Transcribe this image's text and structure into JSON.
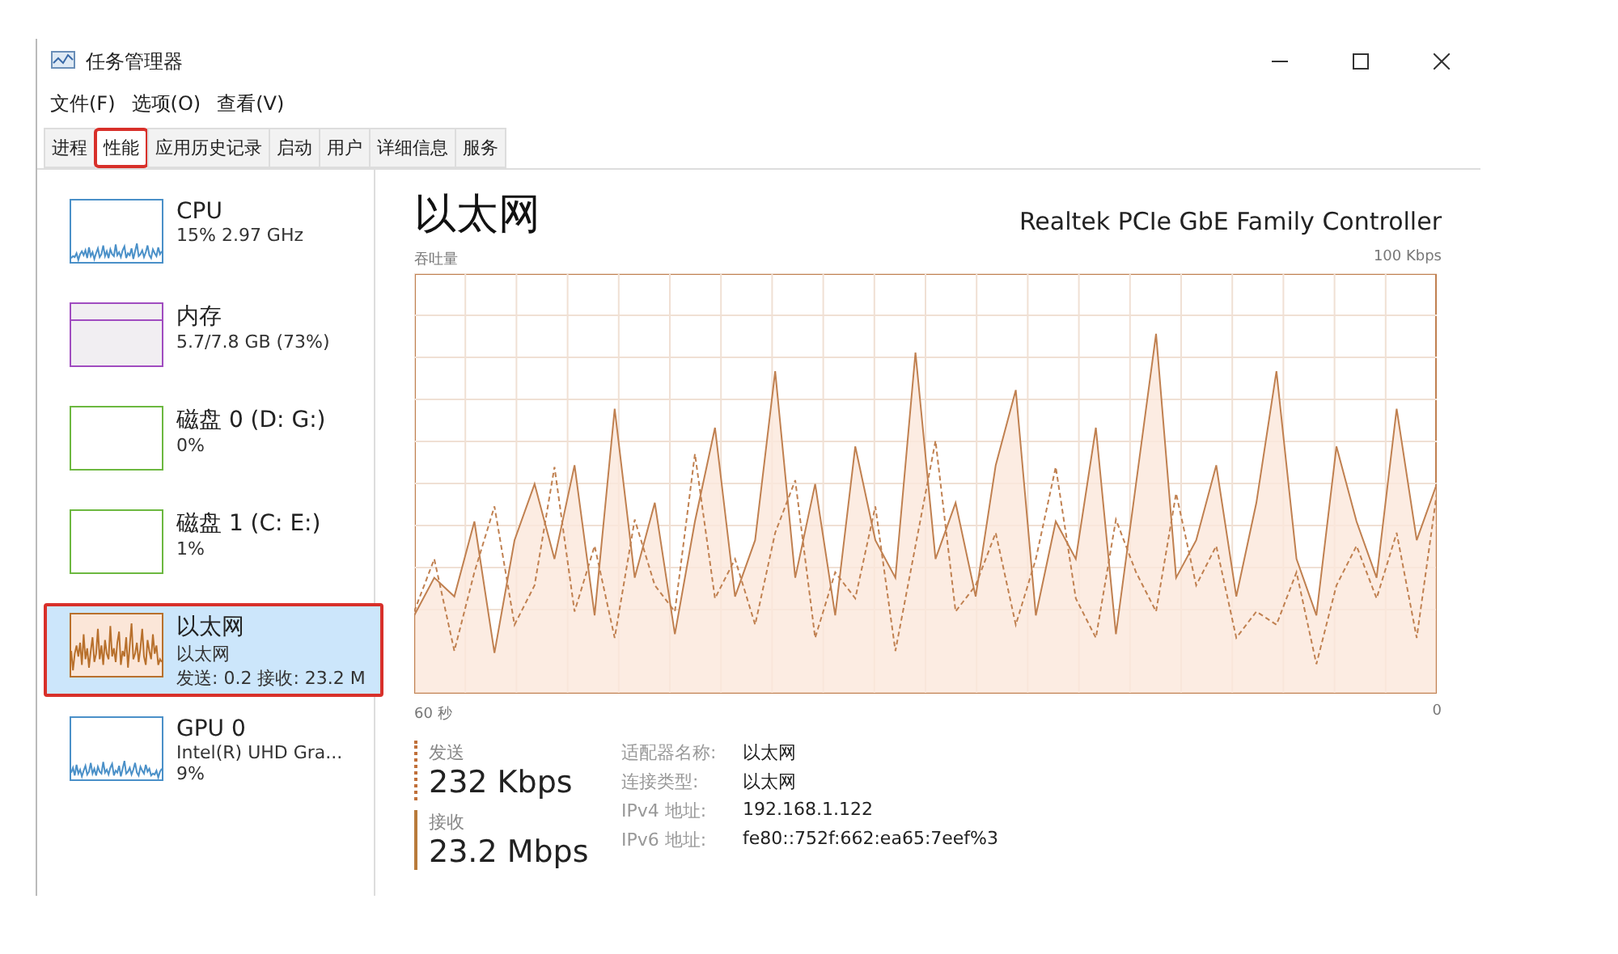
{
  "window": {
    "title": "任务管理器"
  },
  "menu": [
    "文件(F)",
    "选项(O)",
    "查看(V)"
  ],
  "tabs": [
    {
      "label": "进程",
      "selected": false,
      "highlighted": false
    },
    {
      "label": "性能",
      "selected": true,
      "highlighted": true
    },
    {
      "label": "应用历史记录",
      "selected": false,
      "highlighted": false
    },
    {
      "label": "启动",
      "selected": false,
      "highlighted": false
    },
    {
      "label": "用户",
      "selected": false,
      "highlighted": false
    },
    {
      "label": "详细信息",
      "selected": false,
      "highlighted": false
    },
    {
      "label": "服务",
      "selected": false,
      "highlighted": false
    }
  ],
  "sidebar": {
    "items": [
      {
        "kind": "cpu",
        "name": "CPU",
        "lines": [
          "15% 2.97 GHz"
        ],
        "color": "#4a90c8",
        "selected": false,
        "highlighted": false
      },
      {
        "kind": "memory",
        "name": "内存",
        "lines": [
          "5.7/7.8 GB (73%)"
        ],
        "color": "#a04cc0",
        "selected": false,
        "highlighted": false
      },
      {
        "kind": "disk",
        "name": "磁盘 0 (D: G:)",
        "lines": [
          "0%"
        ],
        "color": "#6cb840",
        "selected": false,
        "highlighted": false
      },
      {
        "kind": "disk",
        "name": "磁盘 1 (C: E:)",
        "lines": [
          "1%"
        ],
        "color": "#6cb840",
        "selected": false,
        "highlighted": false
      },
      {
        "kind": "network",
        "name": "以太网",
        "lines": [
          "以太网",
          "发送: 0.2 接收: 23.2 M"
        ],
        "color": "#b8702c",
        "selected": true,
        "highlighted": true
      },
      {
        "kind": "gpu",
        "name": "GPU 0",
        "lines": [
          "Intel(R) UHD Gra...",
          "9%"
        ],
        "color": "#4a90c8",
        "selected": false,
        "highlighted": false
      }
    ]
  },
  "main": {
    "title": "以太网",
    "device": "Realtek PCIe GbE Family Controller",
    "graph_label": "吞吐量",
    "graph_max": "100 Kbps",
    "graph_time": "60 秒",
    "graph_min": "0",
    "stats": [
      {
        "label": "发送",
        "value": "232 Kbps",
        "kind": "send"
      },
      {
        "label": "接收",
        "value": "23.2 Mbps",
        "kind": "receive"
      }
    ],
    "details": [
      {
        "label": "适配器名称:",
        "value": "以太网"
      },
      {
        "label": "连接类型:",
        "value": "以太网"
      },
      {
        "label": "IPv4 地址:",
        "value": "192.168.1.122"
      },
      {
        "label": "IPv6 地址:",
        "value": "fe80::752f:662:ea65:7eef%3"
      }
    ]
  }
}
